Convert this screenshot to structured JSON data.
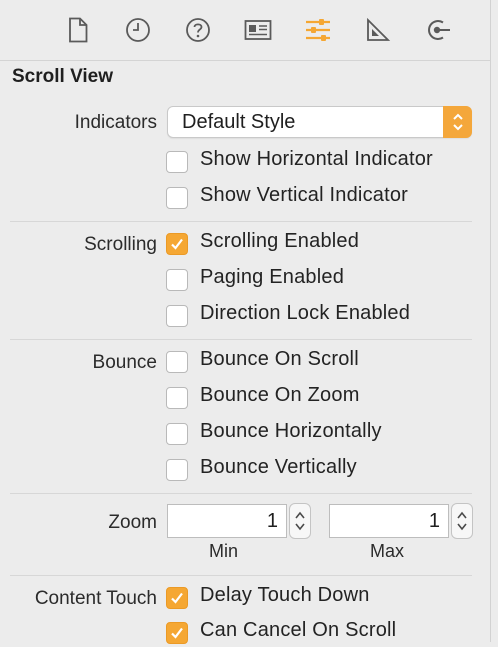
{
  "toolbar": {
    "tabs": [
      {
        "name": "file-inspector",
        "icon": "document-icon"
      },
      {
        "name": "history-inspector",
        "icon": "clock-icon"
      },
      {
        "name": "quick-help-inspector",
        "icon": "question-icon"
      },
      {
        "name": "identity-inspector",
        "icon": "identity-card-icon"
      },
      {
        "name": "attributes-inspector",
        "icon": "sliders-icon",
        "selected": true
      },
      {
        "name": "size-inspector",
        "icon": "ruler-icon"
      },
      {
        "name": "connections-inspector",
        "icon": "connections-icon"
      }
    ],
    "accent": "#f5a733",
    "icon_color": "#5a5a5a"
  },
  "section": {
    "title": "Scroll View"
  },
  "indicators": {
    "label": "Indicators",
    "style_value": "Default Style",
    "options": [
      {
        "label": "Show Horizontal Indicator",
        "checked": false
      },
      {
        "label": "Show Vertical Indicator",
        "checked": false
      }
    ]
  },
  "scrolling": {
    "label": "Scrolling",
    "options": [
      {
        "label": "Scrolling Enabled",
        "checked": true
      },
      {
        "label": "Paging Enabled",
        "checked": false
      },
      {
        "label": "Direction Lock Enabled",
        "checked": false
      }
    ]
  },
  "bounce": {
    "label": "Bounce",
    "options": [
      {
        "label": "Bounce On Scroll",
        "checked": false
      },
      {
        "label": "Bounce On Zoom",
        "checked": false
      },
      {
        "label": "Bounce Horizontally",
        "checked": false
      },
      {
        "label": "Bounce Vertically",
        "checked": false
      }
    ]
  },
  "zoom": {
    "label": "Zoom",
    "min_value": "1",
    "min_caption": "Min",
    "max_value": "1",
    "max_caption": "Max"
  },
  "content_touch": {
    "label": "Content Touch",
    "options": [
      {
        "label": "Delay Touch Down",
        "checked": true
      },
      {
        "label": "Can Cancel On Scroll",
        "checked": true
      }
    ]
  }
}
